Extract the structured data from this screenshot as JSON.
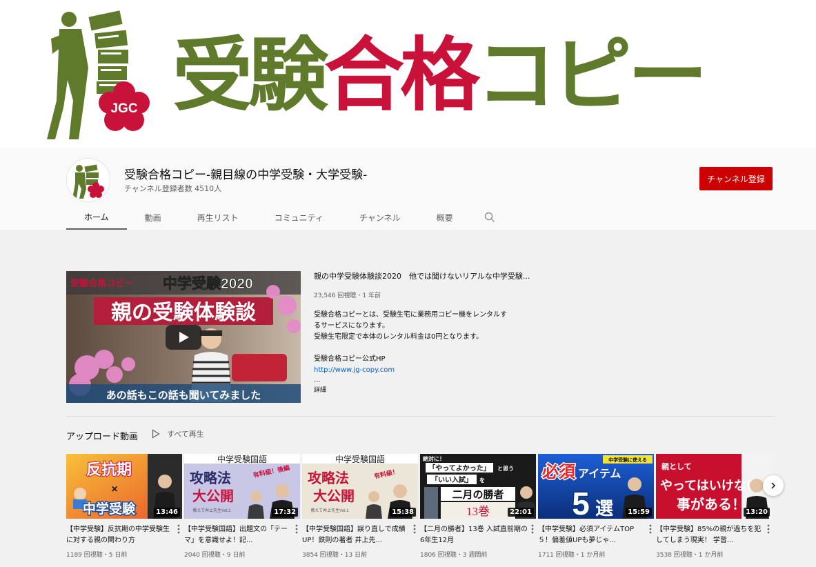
{
  "banner": {
    "logo_badge": "JGC",
    "title_part1": "受験",
    "title_part2": "合格",
    "title_part3": "コピー"
  },
  "channel": {
    "name": "受験合格コピー-親目線の中学受験・大学受験-",
    "subscribers": "チャンネル登録者数 4510人",
    "subscribe_label": "チャンネル登録"
  },
  "tabs": [
    {
      "label": "ホーム",
      "active": true
    },
    {
      "label": "動画"
    },
    {
      "label": "再生リスト"
    },
    {
      "label": "コミュニティ"
    },
    {
      "label": "チャンネル"
    },
    {
      "label": "概要"
    }
  ],
  "featured": {
    "thumb_brand": "受験合格コピー",
    "thumb_headline1": "中学受験2020",
    "thumb_headline2": "親の受験体験談",
    "thumb_caption": "あの話もこの話も聞いてみました",
    "title": "親の中学受験体験談2020　他では聞けないリアルな中学受験...",
    "meta": "23,546 回視聴・1 年前",
    "desc_lines": [
      "受験合格コピーとは、受験生宅に業務用コピー機をレンタルす",
      "るサービスになります。",
      "受験生宅限定で本体のレンタル料金は0円となります。",
      "",
      "受験合格コピー公式HP"
    ],
    "link": "http://www.jg-copy.com",
    "ellipsis": "...",
    "more": "詳細"
  },
  "shelf": {
    "title": "アップロード動画",
    "play_all": "すべて再生"
  },
  "videos": [
    {
      "thumb": {
        "t1": "反抗期",
        "t2": "×",
        "t3": "中学受験"
      },
      "duration": "13:46",
      "title": "【中学受験】反抗期の中学受験生に対する親の関わり方",
      "meta": "1189 回視聴・5 日前"
    },
    {
      "thumb": {
        "t1": "中学受験国語",
        "t2": "攻略法",
        "t3": "大公開",
        "t4": "有料級！後編",
        "t5": "教えて井上先生Vol.2"
      },
      "duration": "17:32",
      "title": "【中学受験国語】出題文の「テーマ」を意識せよ！記...",
      "meta": "2040 回視聴・9 日前"
    },
    {
      "thumb": {
        "t1": "中学受験国語",
        "t2": "攻略法",
        "t3": "大公開",
        "t4": "有料級！",
        "t5": "教えて井上先生Vol.1"
      },
      "duration": "15:38",
      "title": "【中学受験国語】誤り直しで成績UP！鉄則の著者 井上先...",
      "meta": "3854 回視聴・13 日前"
    },
    {
      "thumb": {
        "t0": "絶対に！",
        "t1": "「やってよかった」",
        "t2": "と思う",
        "t3": "「いい入試」",
        "t4": "を",
        "t5": "二月の勝者",
        "t6": "13巻"
      },
      "duration": "22:01",
      "title": "【二月の勝者】13巻 入試直前期の6年生12月",
      "meta": "1806 回視聴・3 週間前"
    },
    {
      "thumb": {
        "t0": "中学受験に使える",
        "t1": "必須",
        "t2": "アイテム",
        "t3": "5",
        "t4": "選"
      },
      "duration": "15:59",
      "title": "【中学受験】必須アイテムTOP５！偏差値UPも夢じゃ...",
      "meta": "1711 回視聴・1 か月前"
    },
    {
      "thumb": {
        "t1": "親として",
        "t2": "やってはいけない",
        "t3": "事がある！"
      },
      "duration": "13:20",
      "title": "【中学受験】85%の親が過ちを犯してしまう現実！ 学習...",
      "meta": "3538 回視聴・1 か月前"
    }
  ],
  "colors": {
    "brand_green": "#5e7a2a",
    "brand_red": "#c8123a",
    "subscribe": "#cc0000",
    "link": "#065fd4"
  }
}
